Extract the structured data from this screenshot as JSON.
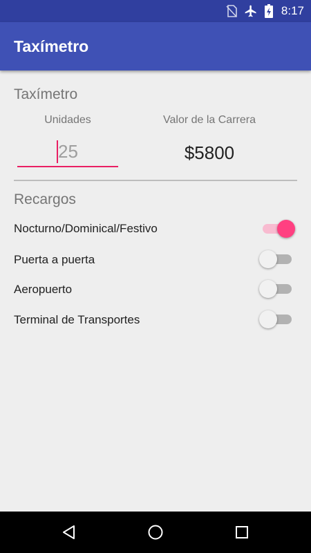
{
  "status_bar": {
    "time": "8:17",
    "icons": [
      "no-sim-icon",
      "airplane-icon",
      "battery-charging-icon"
    ]
  },
  "app_bar": {
    "title": "Taxímetro"
  },
  "meter": {
    "section_title": "Taxímetro",
    "units_label": "Unidades",
    "units_value": "25",
    "fare_label": "Valor de la Carrera",
    "fare_value": "$5800"
  },
  "surcharges": {
    "section_title": "Recargos",
    "items": [
      {
        "label": "Nocturno/Dominical/Festivo",
        "checked": true
      },
      {
        "label": "Puerta a puerta",
        "checked": false
      },
      {
        "label": "Aeropuerto",
        "checked": false
      },
      {
        "label": "Terminal de Transportes",
        "checked": false
      }
    ]
  },
  "colors": {
    "primary": "#3f51b5",
    "primary_dark": "#303f9f",
    "accent": "#ff4081",
    "input_underline": "#e91e63"
  },
  "nav_bar": {
    "buttons": [
      "back-icon",
      "home-icon",
      "recents-icon"
    ]
  }
}
